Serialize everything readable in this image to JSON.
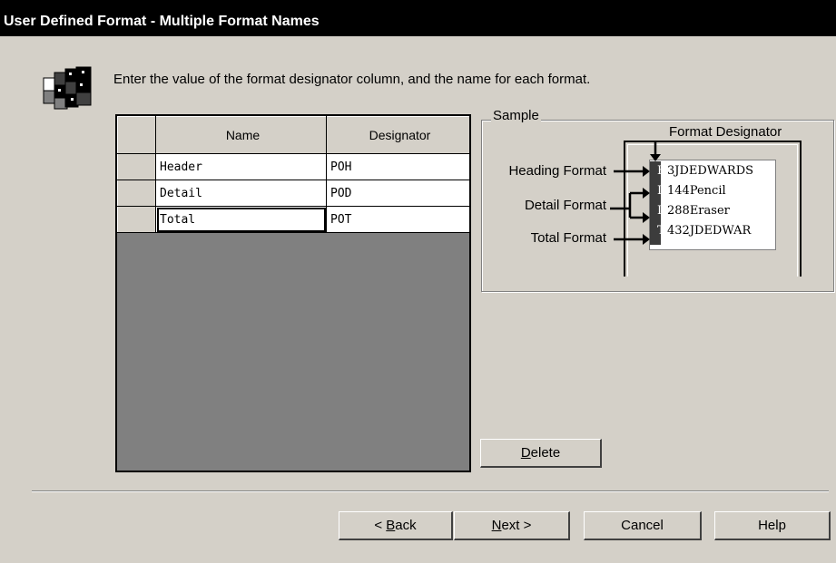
{
  "window": {
    "title": "User Defined Format - Multiple Format Names"
  },
  "instructions": "Enter the value of the format designator column, and the name for each format.",
  "grid": {
    "columns": [
      "Name",
      "Designator"
    ],
    "rows": [
      {
        "name": "Header",
        "designator": "POH"
      },
      {
        "name": "Detail",
        "designator": "POD"
      },
      {
        "name": "Total",
        "designator": "POT"
      }
    ]
  },
  "sample": {
    "legend": "Sample",
    "format_designator_label": "Format Designator",
    "labels": [
      "Heading Format",
      "Detail Format",
      "Total Format"
    ],
    "lines": [
      {
        "designator": "H",
        "text": "3JDEDWARDS"
      },
      {
        "designator": "D",
        "text": "144Pencil"
      },
      {
        "designator": "D",
        "text": "288Eraser"
      },
      {
        "designator": "T",
        "text": "432JDEDWAR"
      }
    ]
  },
  "buttons": {
    "delete": {
      "mnemonic": "D",
      "rest": "elete"
    },
    "back": {
      "prefix": "< ",
      "mnemonic": "B",
      "rest": "ack"
    },
    "next": {
      "mnemonic": "N",
      "rest": "ext >"
    },
    "cancel": "Cancel",
    "help": "Help"
  },
  "icons": {
    "app": "stacked-blocks-icon"
  }
}
